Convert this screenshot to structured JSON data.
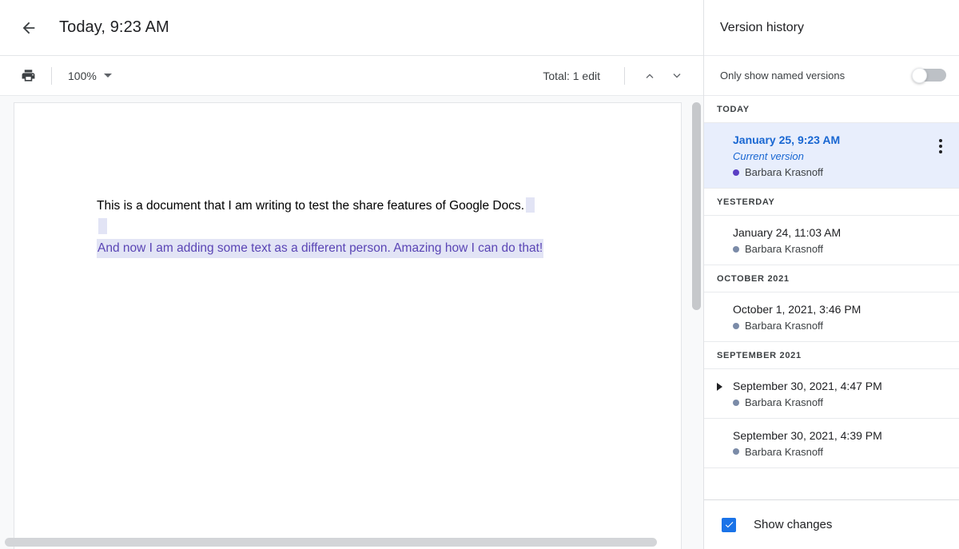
{
  "topbar": {
    "back_icon": "arrow-left-icon",
    "title": "Today, 9:23 AM"
  },
  "actionbar": {
    "print_icon": "print-icon",
    "zoom_value": "100%",
    "zoom_caret_icon": "chevron-down-icon",
    "total_edits": "Total: 1 edit",
    "prev_icon": "chevron-up-icon",
    "next_icon": "chevron-down-icon"
  },
  "document": {
    "paragraph_1": "This is a document that I am writing to test the share features of Google Docs.",
    "paragraph_2": "And now I am adding some text as a different person. Amazing how I can do that!",
    "change_text_color": "#5a45b5",
    "change_highlight_color": "#e2e4f5"
  },
  "panel": {
    "title": "Version history",
    "only_named_label": "Only show named versions",
    "only_named_toggle_state": "off",
    "show_changes_label": "Show changes",
    "show_changes_checked": "true",
    "check_icon": "checkmark-icon",
    "accent_color": "#1a73e8",
    "selected_color": "#1967d2",
    "sections": [
      {
        "heading": "TODAY",
        "items": [
          {
            "date": "January 25, 9:23 AM",
            "current_label": "Current version",
            "author": "Barbara Krasnoff",
            "dot_color": "#5b3fc4",
            "selected": true,
            "expandable": false,
            "menu_icon": "more-vertical-icon"
          }
        ]
      },
      {
        "heading": "YESTERDAY",
        "items": [
          {
            "date": "January 24, 11:03 AM",
            "current_label": "",
            "author": "Barbara Krasnoff",
            "dot_color": "#7b8ba8",
            "selected": false,
            "expandable": false
          }
        ]
      },
      {
        "heading": "OCTOBER 2021",
        "items": [
          {
            "date": "October 1, 2021, 3:46 PM",
            "current_label": "",
            "author": "Barbara Krasnoff",
            "dot_color": "#7b8ba8",
            "selected": false,
            "expandable": false
          }
        ]
      },
      {
        "heading": "SEPTEMBER 2021",
        "items": [
          {
            "date": "September 30, 2021, 4:47 PM",
            "current_label": "",
            "author": "Barbara Krasnoff",
            "dot_color": "#7b8ba8",
            "selected": false,
            "expandable": true,
            "expander_icon": "triangle-right-icon"
          },
          {
            "date": "September 30, 2021, 4:39 PM",
            "current_label": "",
            "author": "Barbara Krasnoff",
            "dot_color": "#7b8ba8",
            "selected": false,
            "expandable": false
          }
        ]
      }
    ]
  }
}
